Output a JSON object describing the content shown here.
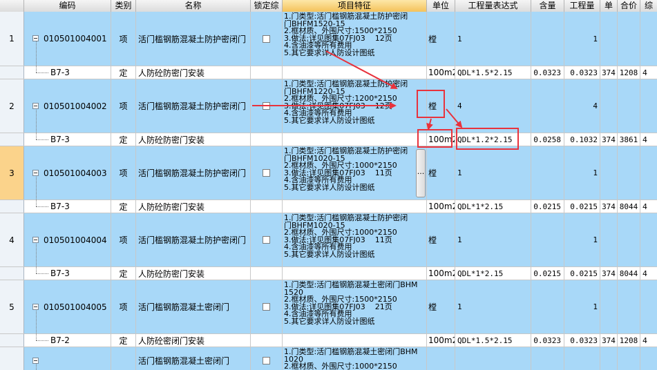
{
  "headers": {
    "code": "编码",
    "type": "类别",
    "name": "名称",
    "lock": "锁定综",
    "feature": "项目特征",
    "unit": "单位",
    "expr": "工程量表达式",
    "content": "含量",
    "amount": "工程量",
    "unit_price": "单",
    "total": "合价",
    "more": "综"
  },
  "rows": [
    {
      "num": "1",
      "code": "010501004001",
      "type": "项",
      "name": "活门槛钢筋混凝土防护密闭门",
      "feature": "1.门类型:活门槛钢筋混凝土防护密闭\n门BHFM1520-15\n2.框材质、外围尺寸:1500*2150\n3.做法:详见图集07FJ03    12页\n4.含油漆等所有费用\n5.其它要求详人防设计图纸",
      "unit": "樘",
      "expr": "1",
      "content": "",
      "amount": "1",
      "unit_price": "",
      "total": ""
    },
    {
      "num": "",
      "code": "B7-3",
      "type": "定",
      "name": "人防砼防密门安装",
      "feature": "",
      "unit": "100m2",
      "expr": "QDL*1.5*2.15",
      "content": "0.0323",
      "amount": "0.0323",
      "unit_price": "374",
      "total": "1208"
    },
    {
      "num": "2",
      "code": "010501004002",
      "type": "项",
      "name": "活门槛钢筋混凝土防护密闭门",
      "feature": "1.门类型:活门槛钢筋混凝土防护密闭\n门BHFM1220-15\n2.框材质、外围尺寸:1200*2150\n3.做法:详见图集07FJ03    12页\n4.含油漆等所有费用\n5.其它要求详人防设计图纸",
      "unit": "樘",
      "expr": "4",
      "content": "",
      "amount": "4",
      "unit_price": "",
      "total": ""
    },
    {
      "num": "",
      "code": "B7-3",
      "type": "定",
      "name": "人防砼防密门安装",
      "feature": "",
      "unit": "100m2",
      "expr": "QDL*1.2*2.15",
      "content": "0.0258",
      "amount": "0.1032",
      "unit_price": "374",
      "total": "3861"
    },
    {
      "num": "3",
      "code": "010501004003",
      "type": "项",
      "name": "活门槛钢筋混凝土防护密闭门",
      "feature": "1.门类型:活门槛钢筋混凝土防护密闭\n门BHFM1020-15\n2.框材质、外围尺寸:1000*2150\n3.做法:详见图集07FJ03    11页\n4.含油漆等所有费用\n5.其它要求详人防设计图纸",
      "unit": "樘",
      "expr": "1",
      "content": "",
      "amount": "1",
      "unit_price": "",
      "total": ""
    },
    {
      "num": "",
      "code": "B7-3",
      "type": "定",
      "name": "人防砼防密门安装",
      "feature": "",
      "unit": "100m2",
      "expr": "QDL*1*2.15",
      "content": "0.0215",
      "amount": "0.0215",
      "unit_price": "374",
      "total": "8044"
    },
    {
      "num": "4",
      "code": "010501004004",
      "type": "项",
      "name": "活门槛钢筋混凝土防护密闭门",
      "feature": "1.门类型:活门槛钢筋混凝土防护密闭\n门BHFM1020-15\n2.框材质、外围尺寸:1000*2150\n3.做法:详见图集07FJ03    11页\n4.含油漆等所有费用\n5.其它要求详人防设计图纸",
      "unit": "樘",
      "expr": "1",
      "content": "",
      "amount": "1",
      "unit_price": "",
      "total": ""
    },
    {
      "num": "",
      "code": "B7-3",
      "type": "定",
      "name": "人防砼防密门安装",
      "feature": "",
      "unit": "100m2",
      "expr": "QDL*1*2.15",
      "content": "0.0215",
      "amount": "0.0215",
      "unit_price": "374",
      "total": "8044"
    },
    {
      "num": "5",
      "code": "010501004005",
      "type": "项",
      "name": "活门槛钢筋混凝土密闭门",
      "feature": "1.门类型:活门槛钢筋混凝土密闭门BHM\n1520\n2.框材质、外围尺寸:1500*2150\n3.做法:详见图集07FJ03    21页\n4.含油漆等所有费用\n5.其它要求详人防设计图纸",
      "unit": "樘",
      "expr": "1",
      "content": "",
      "amount": "1",
      "unit_price": "",
      "total": ""
    },
    {
      "num": "",
      "code": "B7-2",
      "type": "定",
      "name": "人防砼密闭门安装",
      "feature": "",
      "unit": "100m2",
      "expr": "QDL*1.5*2.15",
      "content": "0.0323",
      "amount": "0.0323",
      "unit_price": "374",
      "total": "1208"
    },
    {
      "num": "",
      "code": "",
      "type": "",
      "name": "活门槛钢筋混凝土密闭门",
      "feature": "1.门类型:活门槛钢筋混凝土密闭门BHM\n1020\n2.框材质、外围尺寸:1000*2150",
      "unit": "",
      "expr": "",
      "content": "",
      "amount": "",
      "unit_price": "",
      "total": ""
    }
  ],
  "editor_button": "...",
  "colors": {
    "parent_row": "#a8d8f8",
    "selected_rownum": "#fbd38b",
    "annotation": "#e8323c"
  }
}
